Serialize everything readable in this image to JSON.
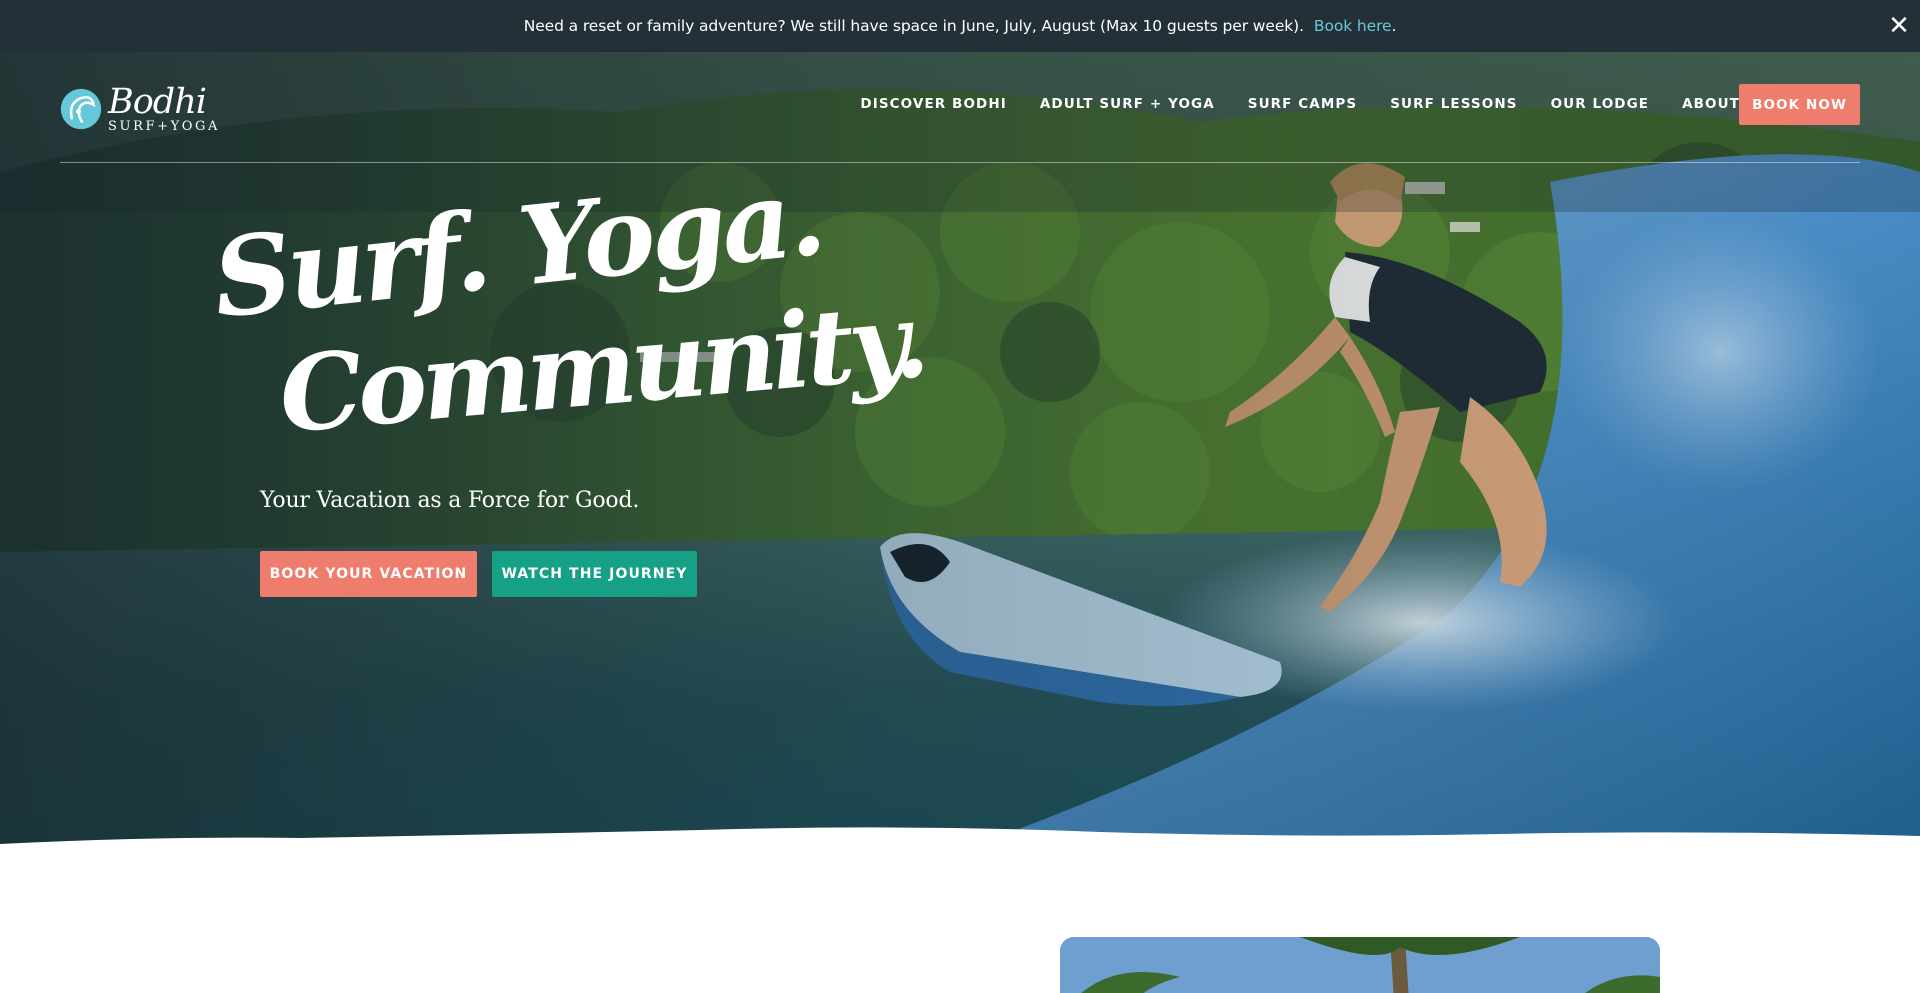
{
  "announcement": {
    "message": "Need a reset or family adventure? We still have space in June, July, August (Max 10 guests per week).",
    "link_label": "Book here",
    "trailing": ".",
    "close_icon": "close-icon"
  },
  "brand": {
    "name": "Bodhi",
    "subtitle": "SURF+YOGA",
    "accent_color": "#66c7d6",
    "coral_color": "#ef7d6e",
    "teal_color": "#16a086"
  },
  "nav": {
    "items": [
      {
        "label": "DISCOVER BODHI"
      },
      {
        "label": "ADULT SURF + YOGA"
      },
      {
        "label": "SURF CAMPS"
      },
      {
        "label": "SURF LESSONS"
      },
      {
        "label": "OUR LODGE"
      },
      {
        "label": "ABOUT"
      }
    ],
    "cta_label": "BOOK NOW"
  },
  "hero": {
    "headline_line1": "Surf. Yoga.",
    "headline_line2": "Community.",
    "tagline": "Your Vacation as a Force for Good.",
    "primary_button": "BOOK YOUR VACATION",
    "secondary_button": "WATCH THE JOURNEY"
  }
}
